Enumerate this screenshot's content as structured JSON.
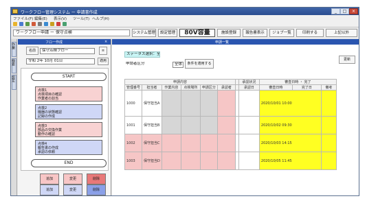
{
  "window": {
    "title": "ワークフロー管理システム ー 申請書作成",
    "buttons": [
      "_",
      "□",
      "×"
    ]
  },
  "menu": [
    "ファイル(F)",
    "編集(E)",
    "表示(V)",
    "ツール(T)",
    "ヘルプ(H)"
  ],
  "toolbar": {
    "path": "ワークフロー申請 ー 保守点検",
    "buttons": [
      "システム管理",
      "設定管理",
      "80V容量",
      "施設登録",
      "報告書表示",
      "ジョブ一覧",
      "印刷する",
      "上記以外"
    ]
  },
  "side_tabs": [
    "作業",
    "検索",
    "設定"
  ],
  "left_panel": {
    "header_left": "フロー作成",
    "header_right": "×",
    "name_button": "名前",
    "name_value": "保守点検フロー",
    "date_value": "令和 2年 10月 01日",
    "apply_button": "適用",
    "start_label": "START",
    "end_label": "END",
    "steps": [
      {
        "title": "点検1",
        "lines": [
          "点検項目の確認",
          "作業者の割当"
        ]
      },
      {
        "title": "点検2",
        "lines": [
          "機器の状態確認",
          "記録の作成"
        ]
      },
      {
        "title": "点検3",
        "lines": [
          "部品の交換作業",
          "動作の確認"
        ]
      },
      {
        "title": "点検4",
        "lines": [
          "報告書の作成",
          "承認の依頼"
        ]
      }
    ],
    "palette": [
      "追加",
      "変更",
      "削除",
      "追加",
      "変更",
      "削除"
    ]
  },
  "right_panel": {
    "header": "申請一覧",
    "filter_label": "ステータス選択：全件",
    "row_label": "申請者区分",
    "select_value": "全体",
    "apply_label": "条件を適用する",
    "top_button": "更新",
    "group_headers": [
      "申請内容",
      "承認状況",
      "審査日時 ・ 完了"
    ],
    "columns": [
      "管理番号",
      "担当者",
      "作業内容",
      "点検場所",
      "申請区分",
      "承認者",
      "承認日",
      "審査日時",
      "完了日",
      "備考"
    ],
    "rows": [
      {
        "id": "1000",
        "name": "保守担当A",
        "date": "2020/10/01 10:00"
      },
      {
        "id": "1001",
        "name": "保守担当B",
        "date": "2020/10/02 09:30"
      },
      {
        "id": "1002",
        "name": "保守担当C",
        "date": "2020/10/03 14:15"
      },
      {
        "id": "1003",
        "name": "保守担当D",
        "date": "2020/10/05 11:45"
      }
    ]
  }
}
